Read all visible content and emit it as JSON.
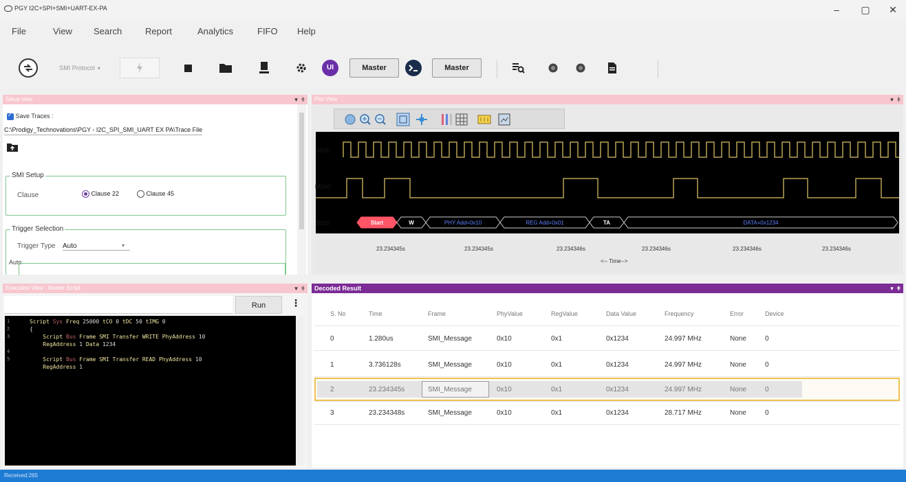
{
  "window": {
    "title": "PGY I2C+SPI+SMI+UART-EX-PA",
    "minimize": "–",
    "maximize": "▢",
    "close": "✕"
  },
  "menu": [
    "File",
    "View",
    "Search",
    "Report",
    "Analytics",
    "FIFO",
    "Help"
  ],
  "toolbar": {
    "protocol_select": "SMI Protocol",
    "ui_badge": "UI",
    "master1": "Master",
    "master2": "Master"
  },
  "setup_view": {
    "header": "Setup view",
    "save_traces_label": "Save Traces :",
    "trace_path": "C:\\Prodigy_Technovations\\PGY - I2C_SPI_SMI_UART EX PA\\Trace File",
    "smi_setup_legend": "SMI Setup",
    "clause_label": "Clause",
    "clause22": "Clause 22",
    "clause45": "Clause 45",
    "trigger_legend": "Trigger Selection",
    "trigger_type_label": "Trigger Type",
    "trigger_type_value": "Auto",
    "auto_legend": "Auto"
  },
  "plot_view": {
    "header": "Plot View",
    "signals": [
      "MDC",
      "MDIO",
      "BUS"
    ],
    "bus_segments": [
      "Start",
      "W",
      "PHY Add=0x10",
      "REG Add=0x01",
      "TA",
      "DATA=0x1234"
    ],
    "time_ticks": [
      "23.234345s",
      "23.234345s",
      "23.234346s",
      "23.234346s",
      "23.234346s",
      "23.234346s"
    ],
    "time_axis_label": "<-- Time-->"
  },
  "execution_view": {
    "header": "Execution View - Master Script",
    "run_button": "Run",
    "more_button": "⋮",
    "lines": [
      {
        "n": "1",
        "text": "Script Sys Freq 25000 tCO 0 tDC 50 tIMG 0"
      },
      {
        "n": "2",
        "text": "{"
      },
      {
        "n": "3",
        "text": "    Script Bus Frame SMI Transfer WRITE PhyAddress 10"
      },
      {
        "n": "",
        "text": "    RegAddress 1 Data 1234"
      },
      {
        "n": "4",
        "text": ""
      },
      {
        "n": "5",
        "text": "    Script Bus Frame SMI Transfer READ PhyAddress 10"
      },
      {
        "n": "",
        "text": "    RegAddress 1"
      }
    ]
  },
  "decoded_result": {
    "header": "Decoded Result",
    "columns": [
      "S. No",
      "Time",
      "Frame",
      "PhyValue",
      "RegValue",
      "Data Value",
      "Frequency",
      "Error",
      "Device"
    ],
    "rows": [
      [
        "0",
        "1.280us",
        "SMI_Message",
        "0x10",
        "0x1",
        "0x1234",
        "24.997 MHz",
        "None",
        "0"
      ],
      [
        "1",
        "3.736128s",
        "SMI_Message",
        "0x10",
        "0x1",
        "0x1234",
        "24.997 MHz",
        "None",
        "0"
      ],
      [
        "2",
        "23.234345s",
        "SMI_Message",
        "0x10",
        "0x1",
        "0x1234",
        "24.997 MHz",
        "None",
        "0"
      ],
      [
        "3",
        "23.234348s",
        "SMI_Message",
        "0x10",
        "0x1",
        "0x1234",
        "28.717 MHz",
        "None",
        "0"
      ]
    ],
    "selected_row": 2
  },
  "status": {
    "text": "Received:265"
  },
  "colors": {
    "panel_header_pink": "#f7c6cf",
    "decoded_header": "#7b2c95",
    "status_bar": "#1e7bd4",
    "signal_line": "#b8a455",
    "selected_row_border": "#f0c050"
  }
}
